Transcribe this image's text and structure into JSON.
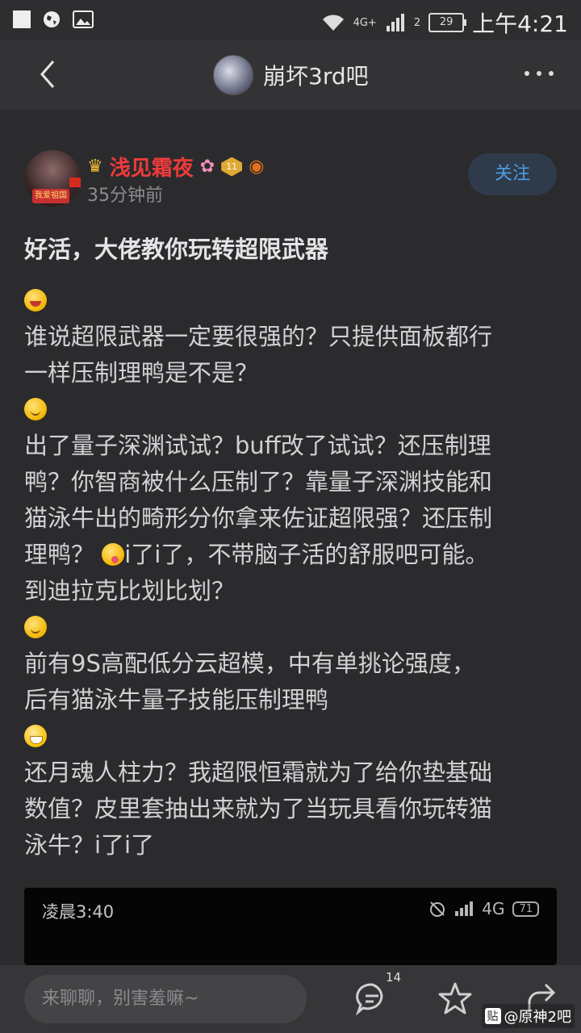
{
  "status_bar": {
    "network_label": "4G+",
    "sim_label": "2",
    "battery": "29",
    "time": "上午4:21"
  },
  "nav": {
    "title": "崩坏3rd吧"
  },
  "post": {
    "username": "浅见霜夜",
    "level": "11",
    "avatar_tag": "我爱祖国",
    "time": "35分钟前",
    "follow_label": "关注",
    "title": "好活，大佬教你玩转超限武器",
    "lines": {
      "l1": "谁说超限武器一定要很强的？只提供面板都行",
      "l2": "一样压制理鸭是不是？",
      "l3": "出了量子深渊试试？buff改了试试？还压制理",
      "l4": "鸭？你智商被什么压制了？靠量子深渊技能和",
      "l5": "猫泳牛出的畸形分你拿来佐证超限强？还压制",
      "l6a": "理鸭？ ",
      "l6b": "i了i了，不带脑子活的舒服吧可能。",
      "l7": "到迪拉克比划比划？",
      "l8": "前有9S高配低分云超模，中有单挑论强度，",
      "l9": "后有猫泳牛量子技能压制理鸭",
      "l10": "还月魂人柱力？我超限恒霜就为了给你垫基础",
      "l11": "数值？皮里套抽出来就为了当玩具看你玩转猫",
      "l12": "泳牛？i了i了"
    },
    "embed": {
      "time": "凌晨3:40",
      "network": "4G",
      "battery": "71"
    }
  },
  "bottom": {
    "placeholder": "来聊聊，别害羞嘛~",
    "comment_count": "14",
    "watermark": "@原神2吧",
    "watermark_logo": "贴"
  },
  "colors": {
    "background": "#2b2b2d",
    "username": "#ee3b3b",
    "follow": "#4f9de8"
  },
  "icons": [
    "back-arrow-icon",
    "more-icon",
    "crown-icon",
    "flower-icon",
    "level-badge-icon",
    "game-controller-icon",
    "comment-icon",
    "star-icon",
    "share-icon"
  ]
}
